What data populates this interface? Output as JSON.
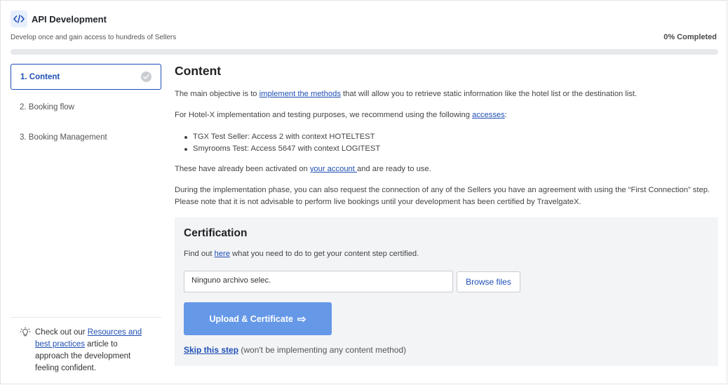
{
  "header": {
    "title": "API Development",
    "subtitle": "Develop once and gain access to hundreds of Sellers",
    "progress_label": "0% Completed",
    "progress_value": 0
  },
  "icons": {
    "app": "code-icon",
    "step_check": "check-circle-icon",
    "tip": "lightbulb-icon",
    "upload_arrow": "arrow-right-icon"
  },
  "colors": {
    "accent": "#1f4fb4",
    "button": "#6698e8",
    "panel": "#f3f4f6"
  },
  "sidebar": {
    "steps": [
      {
        "label": "1. Content"
      },
      {
        "label": "2. Booking flow"
      },
      {
        "label": "3. Booking Management"
      }
    ],
    "tip": {
      "before": "Check out our ",
      "link": "Resources and best practices",
      "after": " article to approach the development feeling confident."
    }
  },
  "main": {
    "title": "Content",
    "p1": {
      "before": "The main objective is to ",
      "link": "implement the methods",
      "after": " that will allow you to retrieve static information like the hotel list or the destination list."
    },
    "p2": {
      "before": "For Hotel-X implementation and testing purposes, we recommend using the following ",
      "link": "accesses",
      "after": ":"
    },
    "bullets": [
      "TGX Test Seller: Access 2 with context HOTELTEST",
      "Smyrooms Test: Access 5647 with context LOGITEST"
    ],
    "p3": {
      "before": "These have already been activated on ",
      "link": "your account ",
      "after": "and are ready to use."
    },
    "p4": "During the implementation phase, you can also request the connection of any of the Sellers you have an agreement with using the “First Connection” step. Please note that it is not advisable to perform live bookings until your development has been certified by TravelgateX."
  },
  "certification": {
    "title": "Certification",
    "text": {
      "before": "Find out ",
      "link": "here",
      "after": " what you need to do to get your content step certified."
    },
    "file_value": "Ninguno archivo selec.",
    "browse_label": "Browse files",
    "upload_label": "Upload & Certificate",
    "skip_link": "Skip this step",
    "skip_note": " (won't be implementing any content method)"
  }
}
